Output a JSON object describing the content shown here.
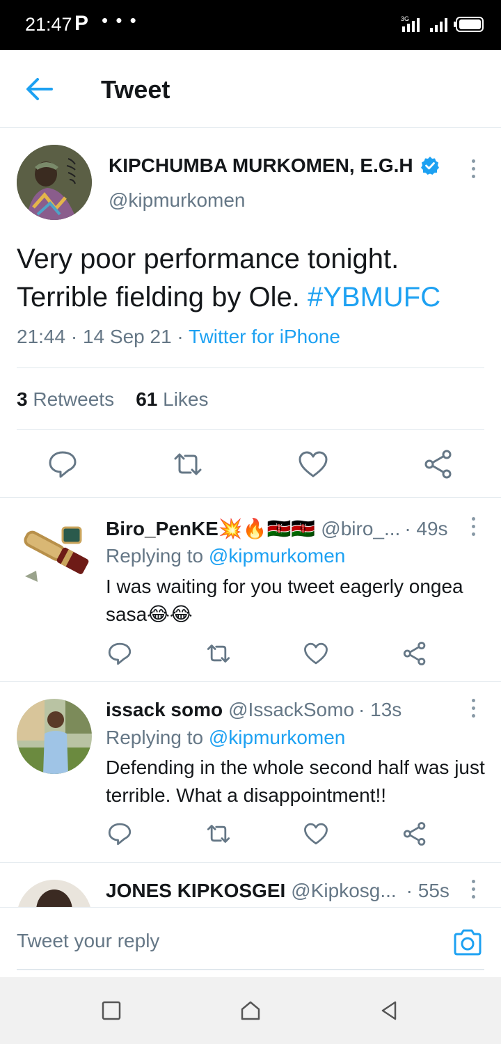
{
  "status_bar": {
    "time": "21:47",
    "notification_icon": "P",
    "more": "• • •",
    "network": "3G"
  },
  "header": {
    "title": "Tweet"
  },
  "tweet": {
    "author_name": "KIPCHUMBA MURKOMEN, E.G.H",
    "handle": "@kipmurkomen",
    "verified": true,
    "text": "Very poor performance tonight. Terrible fielding by Ole.",
    "hashtag": "#YBMUFC",
    "time": "21:44",
    "date": "14 Sep 21",
    "source": "Twitter for iPhone",
    "retweets_count": "3",
    "retweets_label": "Retweets",
    "likes_count": "61",
    "likes_label": "Likes"
  },
  "replies": [
    {
      "name": "Biro_PenKE💥🔥🇰🇪🇰🇪",
      "handle": "@biro_...",
      "time": "· 49s",
      "replying_label": "Replying to",
      "replying_to": "@kipmurkomen",
      "text": "I was waiting for you tweet eagerly ongea sasa😂😂"
    },
    {
      "name": "issack somo",
      "handle": "@IssackSomo",
      "time": "· 13s",
      "replying_label": "Replying to",
      "replying_to": "@kipmurkomen",
      "text": "Defending in the whole second half was just terrible. What a disappointment!!"
    },
    {
      "name": "JONES KIPKOSGEI",
      "handle": "@Kipkosg...",
      "time": "· 55s"
    }
  ],
  "compose": {
    "placeholder": "Tweet your reply"
  },
  "colors": {
    "accent": "#1da1f2",
    "secondary_text": "#657786",
    "border": "#e1e8ed"
  },
  "icons": [
    "back-arrow-icon",
    "verified-badge-icon",
    "more-vertical-icon",
    "reply-icon",
    "retweet-icon",
    "like-icon",
    "share-icon",
    "camera-icon",
    "recent-apps-icon",
    "home-icon",
    "back-nav-icon"
  ]
}
